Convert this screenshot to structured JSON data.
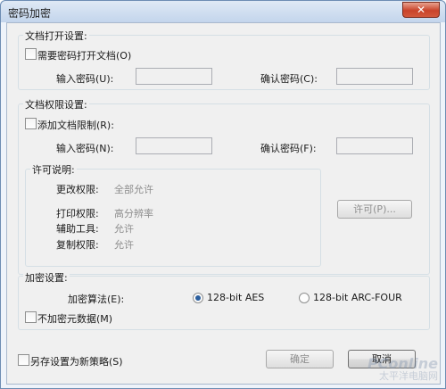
{
  "window": {
    "title": "密码加密",
    "close_glyph": "✕"
  },
  "open_settings": {
    "group_label": "文档打开设置:",
    "require_checkbox_label": "需要密码打开文档(O)",
    "password_label": "输入密码(U):",
    "confirm_label": "确认密码(C):",
    "password_value": "",
    "confirm_value": ""
  },
  "permission_settings": {
    "group_label": "文档权限设置:",
    "restrict_checkbox_label": "添加文档限制(R):",
    "password_label": "输入密码(N):",
    "confirm_label": "确认密码(F):",
    "password_value": "",
    "confirm_value": "",
    "license": {
      "group_label": "许可说明:",
      "rows": [
        {
          "label": "更改权限:",
          "value": "全部允许"
        },
        {
          "label": "打印权限:",
          "value": "高分辨率"
        },
        {
          "label": "辅助工具:",
          "value": "允许"
        },
        {
          "label": "复制权限:",
          "value": "允许"
        }
      ],
      "permit_button": "许可(P)..."
    }
  },
  "encrypt_settings": {
    "group_label": "加密设置:",
    "algorithm_label": "加密算法(E):",
    "options": [
      {
        "label": "128-bit AES",
        "selected": true
      },
      {
        "label": "128-bit ARC-FOUR",
        "selected": false
      }
    ],
    "no_metadata_label": "不加密元数据(M)"
  },
  "footer": {
    "save_policy_label": "另存设置为新策略(S)",
    "ok_button": "确定",
    "cancel_button": "取消"
  },
  "watermark": {
    "brand": "PConline",
    "sub": "太平洋电脑网"
  }
}
